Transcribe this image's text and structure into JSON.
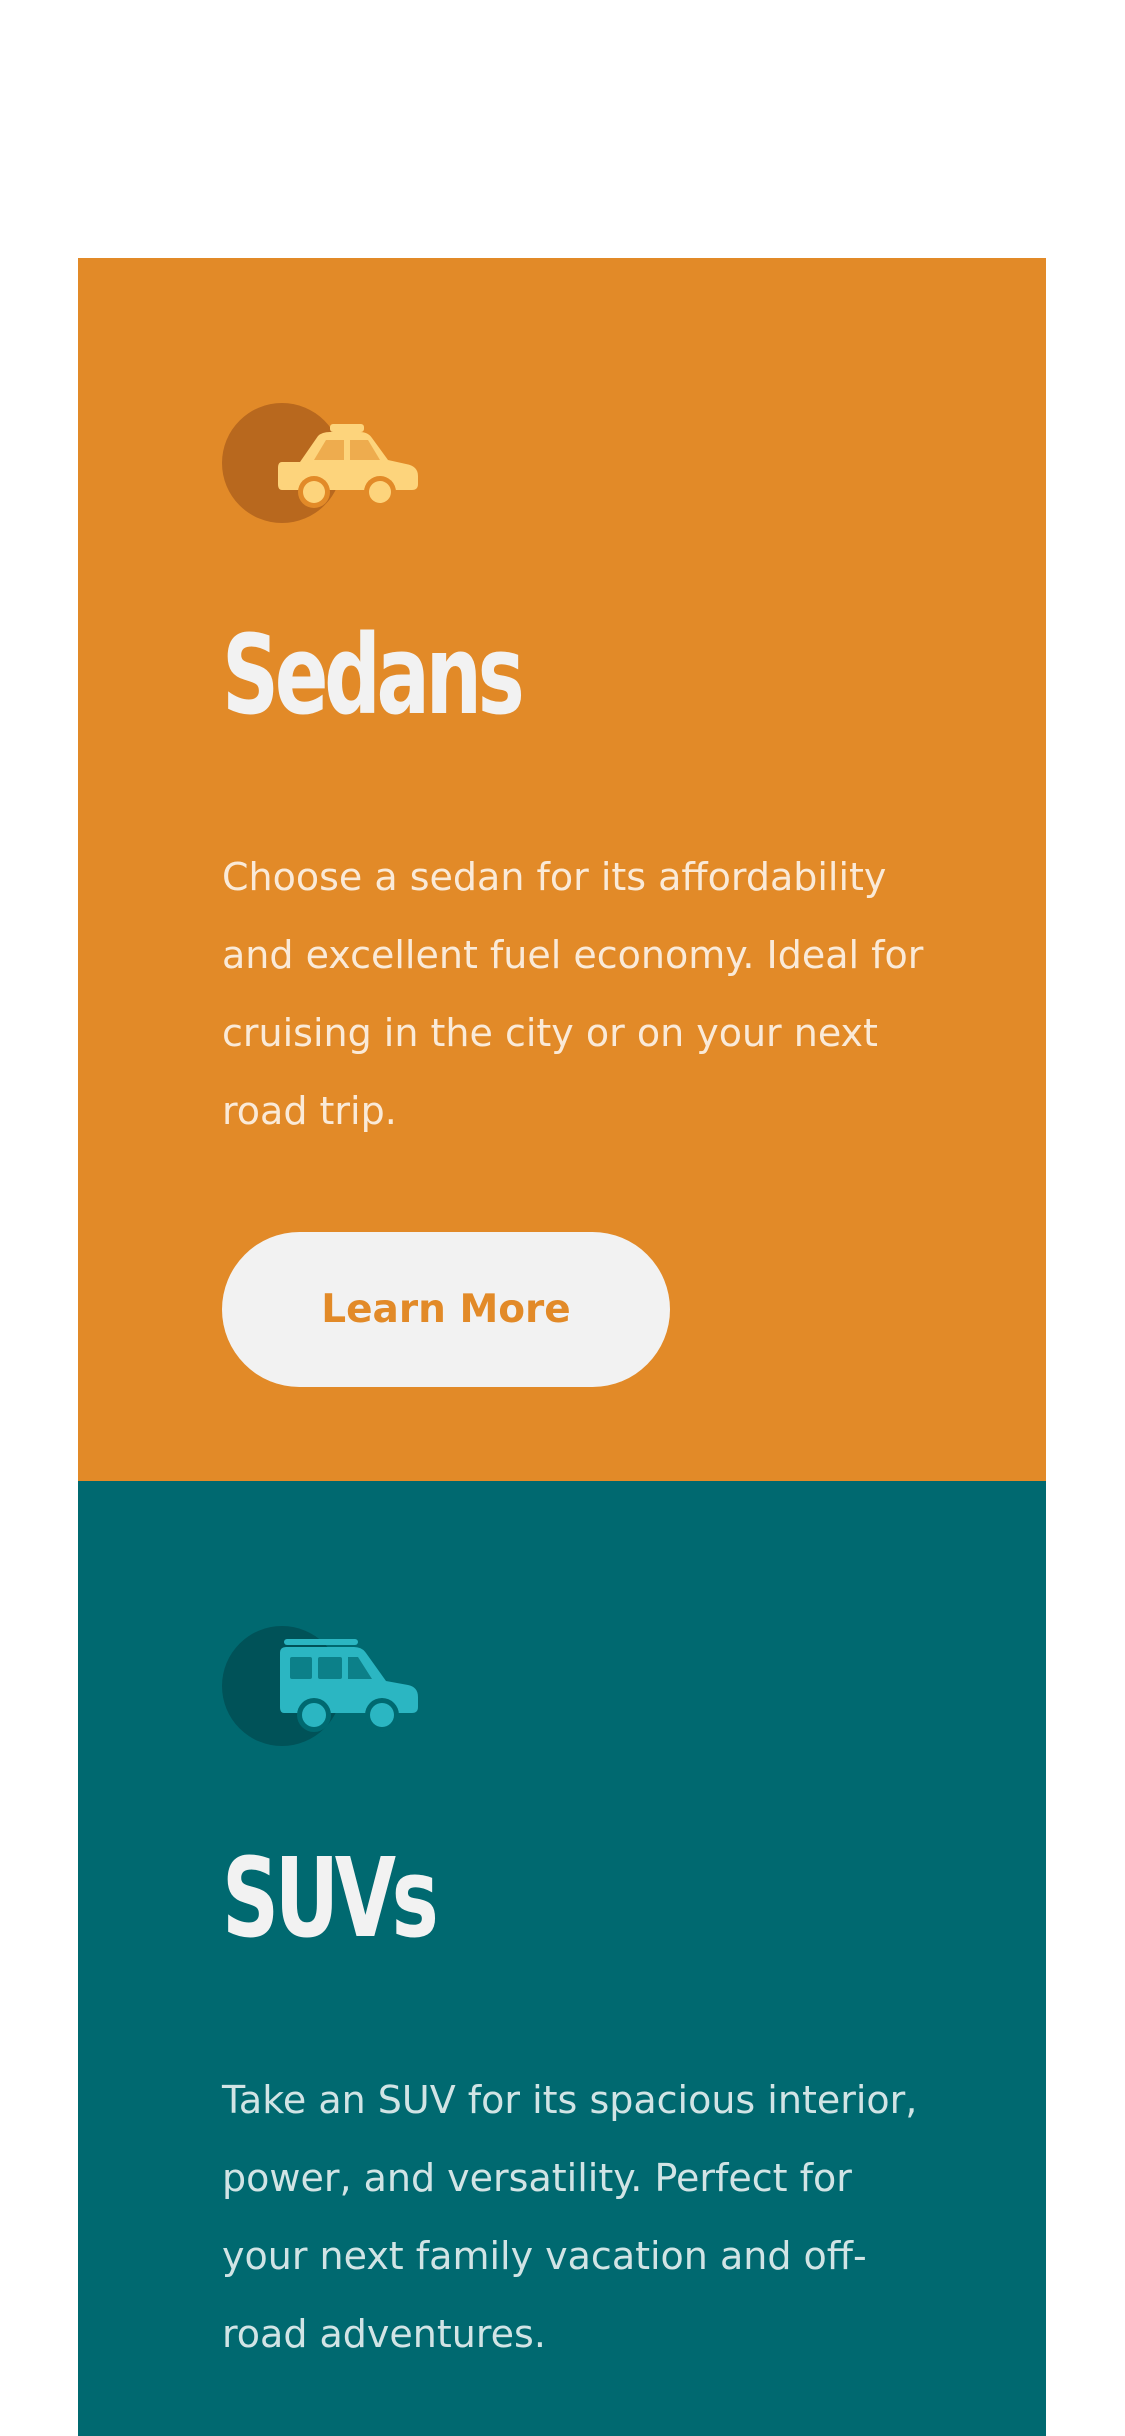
{
  "sedans": {
    "title": "Sedans",
    "description": "Choose a sedan for its affordability and excellent fuel economy. Ideal for cruising in the city or on your next road trip.",
    "button_label": "Learn More",
    "icon": "sedan-car-icon",
    "color": "#E28A28"
  },
  "suvs": {
    "title": "SUVs",
    "description": "Take an SUV for its spacious interior, power, and versatility. Perfect for your next family vacation and off-road adventures.",
    "icon": "suv-car-icon",
    "color": "#006970"
  }
}
